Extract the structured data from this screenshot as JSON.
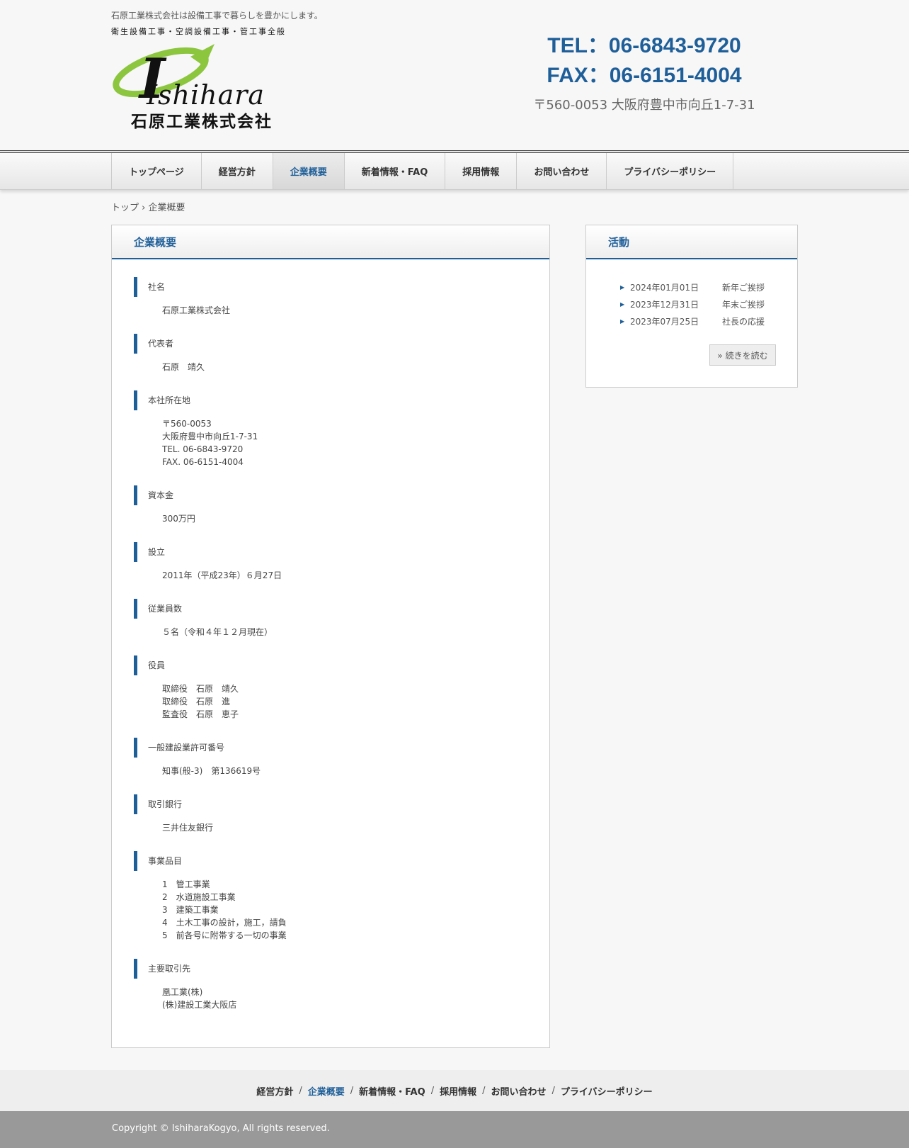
{
  "header": {
    "tagline": "石原工業株式会社は設備工事で暮らしを豊かにします。",
    "logo": {
      "subtitle": "衛生設備工事・空調設備工事・管工事全般",
      "wordmark": "Ishihara",
      "company": "石原工業株式会社"
    },
    "tel": "TEL：06-6843-9720",
    "fax": "FAX：06-6151-4004",
    "address": "〒560-0053 大阪府豊中市向丘1-7-31"
  },
  "nav": {
    "items": [
      "トップページ",
      "経営方針",
      "企業概要",
      "新着情報・FAQ",
      "採用情報",
      "お問い合わせ",
      "プライバシーポリシー"
    ],
    "active_index": 2
  },
  "breadcrumb": {
    "home": "トップ",
    "sep": "›",
    "current": "企業概要"
  },
  "main": {
    "title": "企業概要",
    "sections": [
      {
        "title": "社名",
        "lines": [
          "石原工業株式会社"
        ]
      },
      {
        "title": "代表者",
        "lines": [
          "石原　靖久"
        ]
      },
      {
        "title": "本社所在地",
        "lines": [
          "〒560-0053",
          "大阪府豊中市向丘1-7-31",
          "TEL. 06-6843-9720",
          "FAX. 06-6151-4004"
        ]
      },
      {
        "title": "資本金",
        "lines": [
          "300万円"
        ]
      },
      {
        "title": "設立",
        "lines": [
          "2011年（平成23年）６月27日"
        ]
      },
      {
        "title": "従業員数",
        "lines": [
          "５名（令和４年１２月現在）"
        ]
      },
      {
        "title": "役員",
        "lines": [
          "取締役　石原　靖久",
          "取締役　石原　進",
          "監査役　石原　恵子"
        ]
      },
      {
        "title": "一般建設業許可番号",
        "lines": [
          "知事(般-3)　第136619号"
        ]
      },
      {
        "title": "取引銀行",
        "lines": [
          "三井住友銀行"
        ]
      },
      {
        "title": "事業品目",
        "lines": [
          "1　管工事業",
          "2　水道施設工事業",
          "3　建築工事業",
          "4　土木工事の設計，施工，請負",
          "5　前各号に附帯する一切の事業"
        ]
      },
      {
        "title": "主要取引先",
        "lines": [
          "凰工業(株)",
          "(株)建設工業大阪店"
        ]
      }
    ]
  },
  "sidebar": {
    "title": "活動",
    "news": [
      {
        "date": "2024年01月01日",
        "title": "新年ご挨拶"
      },
      {
        "date": "2023年12月31日",
        "title": "年末ご挨拶"
      },
      {
        "date": "2023年07月25日",
        "title": "社長の応援"
      }
    ],
    "more_label": "» 続きを読む"
  },
  "footer": {
    "links": [
      "経営方針",
      "企業概要",
      "新着情報・FAQ",
      "採用情報",
      "お問い合わせ",
      "プライバシーポリシー"
    ],
    "active_index": 1,
    "separator": "/",
    "copyright": "Copyright © IshiharaKogyo, All rights reserved."
  },
  "colors": {
    "accent": "#1f5f99",
    "logo_green": "#8cc63f"
  }
}
